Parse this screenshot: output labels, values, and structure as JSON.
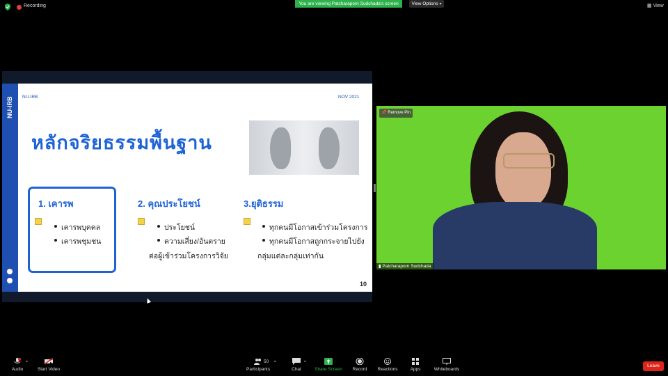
{
  "top_bar": {
    "recording_label": "Recording",
    "viewing_banner": "You are viewing Patcharaporn Sudchada's screen",
    "view_options_label": "View Options",
    "view_label": "View"
  },
  "slide": {
    "sidebar_text": "NU-IRB",
    "header_left": "NU-IRB",
    "header_right": "NOV 2021",
    "title": "หลักจริยธรรมพื้นฐาน",
    "columns": [
      {
        "heading": "1. เคารพ",
        "items": [
          "เคารพบุคคล",
          "เคารพชุมชน"
        ]
      },
      {
        "heading": "2. คุณประโยชน์",
        "items": [
          "ประโยชน์",
          "ความเสี่ยง/อันตราย",
          "ต่อผู้เข้าร่วมโครงการวิจัย"
        ]
      },
      {
        "heading": "3.ยุติธรรม",
        "items": [
          "ทุกคนมีโอกาสเข้าร่วมโครงการ",
          "ทุกคนมีโอกาสถูกกระจายไปยัง",
          "กลุ่มแต่ละกลุ่มเท่ากัน"
        ]
      }
    ],
    "page_number": "10"
  },
  "video": {
    "remove_pin_label": "Remove Pin",
    "participant_name": "Patcharaporn Sudchada"
  },
  "toolbar": {
    "audio_label": "Audio",
    "start_video_label": "Start Video",
    "participants_label": "Participants",
    "participants_count": "50",
    "chat_label": "Chat",
    "share_screen_label": "Share Screen",
    "record_label": "Record",
    "reactions_label": "Reactions",
    "apps_label": "Apps",
    "whiteboards_label": "Whiteboards",
    "leave_label": "Leave"
  },
  "colors": {
    "accent_blue": "#1e63d6",
    "banner_green": "#2fb24c",
    "leave_red": "#e0241a",
    "green_screen": "#6bd22f"
  }
}
